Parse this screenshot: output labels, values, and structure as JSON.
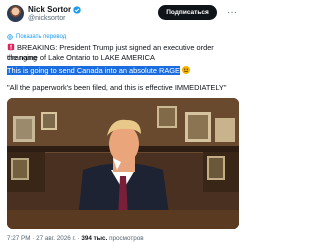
{
  "author": {
    "name": "Nick Sortor",
    "handle": "@nicksortor"
  },
  "actions": {
    "subscribe_label": "Подписаться",
    "more_label": "···"
  },
  "translate": {
    "label": "Показать перевод"
  },
  "tweet": {
    "line1": "BREAKING: President Trump just signed an executive order changing",
    "line2": "the name of Lake Ontario to LAKE AMERICA",
    "line3": "This is going to send Canada into an absolute RAGE",
    "line4": "\"All the paperwork's been filed, and this is effective IMMEDIATELY\""
  },
  "meta": {
    "time": "7:27 PM",
    "date": "27 авг. 2026 г.",
    "views_count": "394 тыс.",
    "views_label": "просмотров"
  },
  "colors": {
    "accent": "#1d9bf0",
    "selection": "#1a6de1",
    "text": "#0f1419",
    "muted": "#536471"
  },
  "icons": {
    "verified": "verified-badge-icon",
    "siren": "siren-icon",
    "emoji": "grinning-emoji-icon",
    "translate": "translate-globe-icon"
  }
}
